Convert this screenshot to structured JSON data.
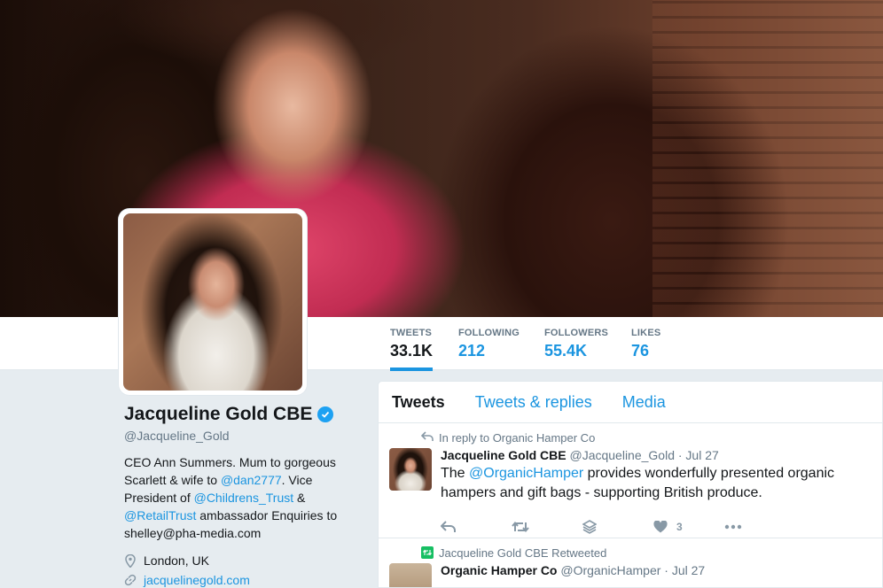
{
  "profile": {
    "name": "Jacqueline Gold CBE",
    "handle": "@Jacqueline_Gold",
    "bio_parts": {
      "p1": "CEO Ann Summers. Mum to gorgeous Scarlett & wife to ",
      "m1": "@dan2777",
      "p2": ". Vice President of ",
      "m2": "@Childrens_Trust",
      "p3": " & ",
      "m3": "@RetailTrust",
      "p4": " ambassador Enquiries to shelley@pha-media.com"
    },
    "location": "London, UK",
    "website": "jacquelinegold.com"
  },
  "stats": [
    {
      "label": "TWEETS",
      "value": "33.1K"
    },
    {
      "label": "FOLLOWING",
      "value": "212"
    },
    {
      "label": "FOLLOWERS",
      "value": "55.4K"
    },
    {
      "label": "LIKES",
      "value": "76"
    }
  ],
  "tabs": [
    "Tweets",
    "Tweets & replies",
    "Media"
  ],
  "tweets": [
    {
      "context": "In reply to Organic Hamper Co",
      "name": "Jacqueline Gold CBE",
      "handle_date": "@Jacqueline_Gold · Jul 27",
      "text_parts": {
        "p1": "The ",
        "m1": "@OrganicHamper",
        "p2": " provides wonderfully presented organic hampers and gift bags - supporting British produce."
      },
      "like_count": "3"
    },
    {
      "context": "Jacqueline Gold CBE Retweeted",
      "name": "Organic Hamper Co",
      "handle_date": "@OrganicHamper · Jul 27"
    }
  ],
  "colors": {
    "accent": "#1b95e0",
    "verified": "#1da1f2",
    "retweet": "#17bf63"
  }
}
